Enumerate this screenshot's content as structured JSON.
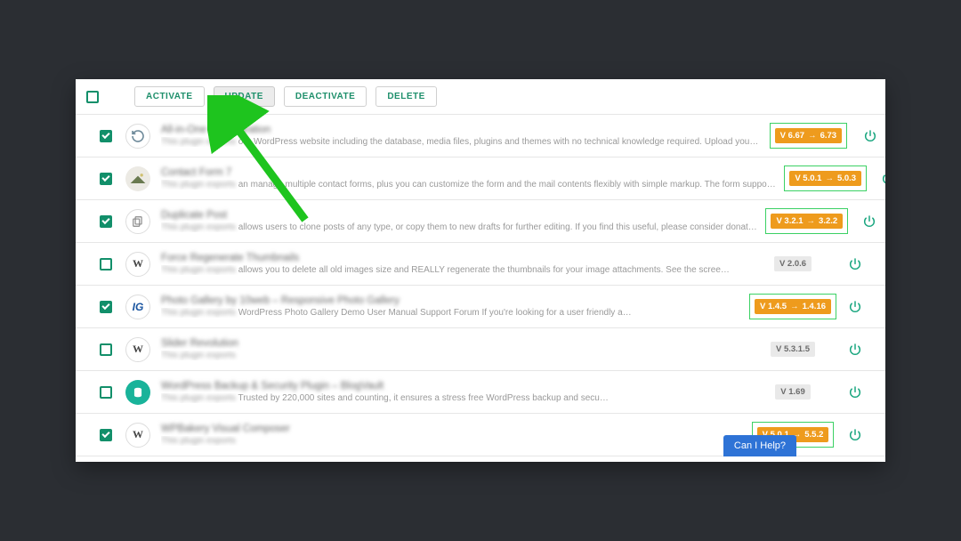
{
  "toolbar": {
    "activate": "ACTIVATE",
    "update": "UPDATE",
    "deactivate": "DEACTIVATE",
    "delete": "DELETE"
  },
  "help_label": "Can I Help?",
  "plugins": [
    {
      "name": "All-in-One WP Migration",
      "desc_tail": "our WordPress website including the database, media files, plugins and themes with no technical knowledge required. Upload you…",
      "checked": true,
      "icon": "refresh",
      "version_from": "V 6.67",
      "version_to": "6.73",
      "has_update": true
    },
    {
      "name": "Contact Form 7",
      "desc_tail": "an manage multiple contact forms, plus you can customize the form and the mail contents flexibly with simple markup. The form suppo…",
      "checked": true,
      "icon": "cf7",
      "version_from": "V 5.0.1",
      "version_to": "5.0.3",
      "has_update": true
    },
    {
      "name": "Duplicate Post",
      "desc_tail": "allows users to clone posts of any type, or copy them to new drafts for further editing. If you find this useful, please consider donat…",
      "checked": true,
      "icon": "copy",
      "version_from": "V 3.2.1",
      "version_to": "3.2.2",
      "has_update": true
    },
    {
      "name": "Force Regenerate Thumbnails",
      "desc_tail": "allows you to delete all old images size and REALLY regenerate the thumbnails for your image attachments. See the scree…",
      "checked": false,
      "icon": "wp",
      "version_plain": "V 2.0.6",
      "has_update": false
    },
    {
      "name": "Photo Gallery by 10web – Responsive Photo Gallery",
      "desc_tail": "WordPress Photo Gallery Demo User Manual Support Forum If you're looking for a user friendly a…",
      "checked": true,
      "icon": "ig",
      "version_from": "V 1.4.5",
      "version_to": "1.4.16",
      "has_update": true
    },
    {
      "name": "Slider Revolution",
      "desc_tail": "",
      "checked": false,
      "icon": "wp",
      "version_plain": "V 5.3.1.5",
      "has_update": false
    },
    {
      "name": "WordPress Backup & Security Plugin – BlogVault",
      "desc_tail": "Trusted by 220,000 sites and counting, it ensures a stress free WordPress backup and secu…",
      "checked": false,
      "icon": "bv",
      "version_plain": "V 1.69",
      "has_update": false
    },
    {
      "name": "WPBakery Visual Composer",
      "desc_tail": "",
      "checked": true,
      "icon": "wp",
      "version_from": "V 5.0.1",
      "version_to": "5.5.2",
      "has_update": true
    }
  ]
}
